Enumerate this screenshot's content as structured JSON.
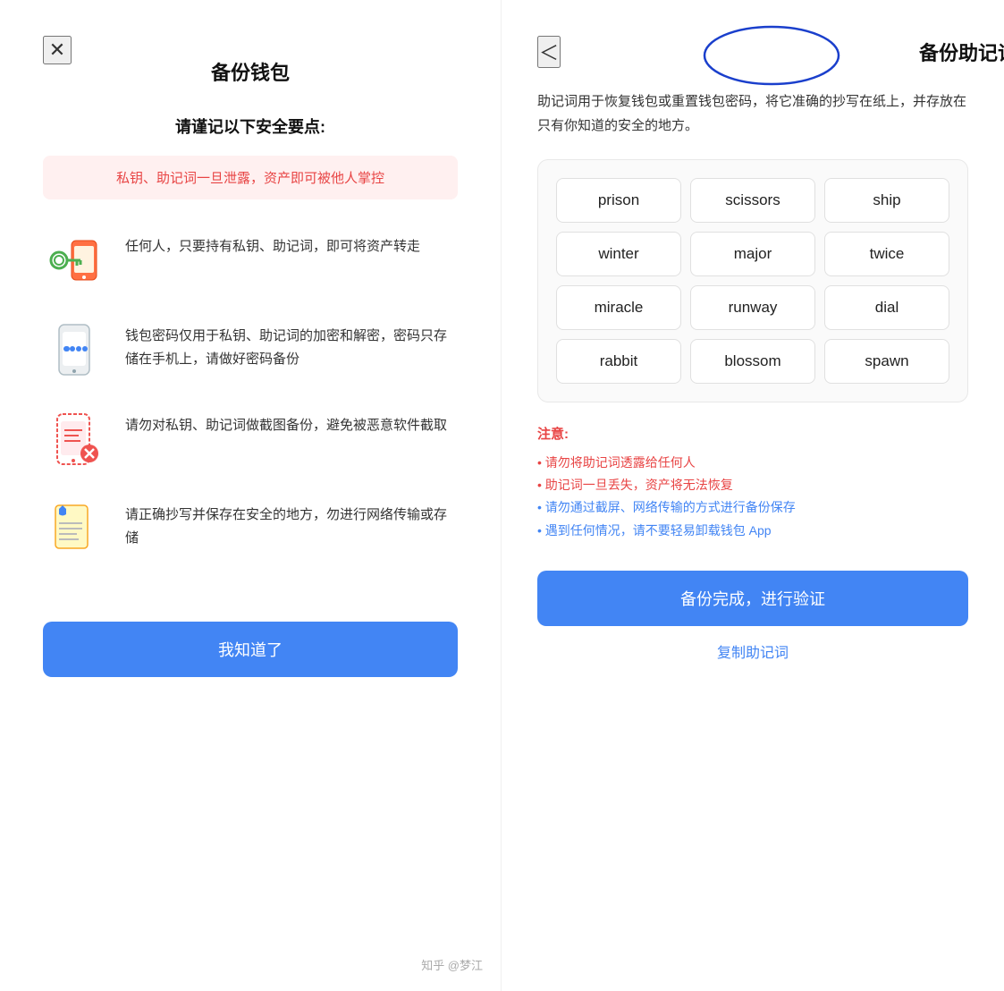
{
  "left": {
    "close_label": "✕",
    "title": "备份钱包",
    "safety_heading": "请谨记以下安全要点:",
    "warning_text": "私钥、助记词一旦泄露，资产即可被他人掌控",
    "tips": [
      {
        "icon": "🔑📱",
        "text": "任何人，只要持有私钥、助记词，即可将资产转走"
      },
      {
        "icon": "📱",
        "text": "钱包密码仅用于私钥、助记词的加密和解密，密码只存储在手机上，请做好密码备份"
      },
      {
        "icon": "📵",
        "text": "请勿对私钥、助记词做截图备份，避免被恶意软件截取"
      },
      {
        "icon": "📄",
        "text": "请正确抄写并保存在安全的地方，勿进行网络传输或存储"
      }
    ],
    "button_label": "我知道了"
  },
  "right": {
    "back_label": "＜",
    "title": "备份助记词",
    "description": "助记词用于恢复钱包或重置钱包密码，将它准确的抄写在纸上，并存放在只有你知道的安全的地方。",
    "mnemonic_words": [
      "prison",
      "scissors",
      "ship",
      "winter",
      "major",
      "twice",
      "miracle",
      "runway",
      "dial",
      "rabbit",
      "blossom",
      "spawn"
    ],
    "notice_title": "注意:",
    "notice_items": [
      {
        "text": "• 请勿将助记词透露给任何人",
        "color": "red"
      },
      {
        "text": "• 助记词一旦丢失，资产将无法恢复",
        "color": "red"
      },
      {
        "text": "• 请勿通过截屏、网络传输的方式进行备份保存",
        "color": "blue"
      },
      {
        "text": "• 遇到任何情况，请不要轻易卸载钱包 App",
        "color": "blue"
      }
    ],
    "verify_button_label": "备份完成，进行验证",
    "copy_label": "复制助记词"
  },
  "watermark": "知乎 @梦江"
}
